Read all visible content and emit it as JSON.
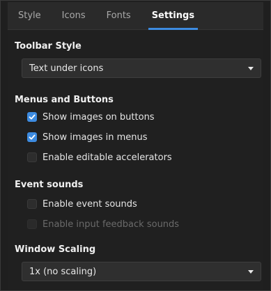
{
  "tabs": [
    {
      "label": "Style"
    },
    {
      "label": "Icons"
    },
    {
      "label": "Fonts"
    },
    {
      "label": "Settings"
    }
  ],
  "active_tab": "Settings",
  "toolbar_style": {
    "title": "Toolbar Style",
    "selected": "Text under icons"
  },
  "menus_buttons": {
    "title": "Menus and Buttons",
    "options": [
      {
        "label": "Show images on buttons",
        "checked": true
      },
      {
        "label": "Show images in menus",
        "checked": true
      },
      {
        "label": "Enable editable accelerators",
        "checked": false
      }
    ]
  },
  "event_sounds": {
    "title": "Event sounds",
    "options": [
      {
        "label": "Enable event sounds",
        "checked": false,
        "enabled": true
      },
      {
        "label": "Enable input feedback sounds",
        "checked": false,
        "enabled": false
      }
    ]
  },
  "window_scaling": {
    "title": "Window Scaling",
    "selected": "1x (no scaling)"
  },
  "colors": {
    "accent": "#3d8be0",
    "background": "#202020"
  }
}
